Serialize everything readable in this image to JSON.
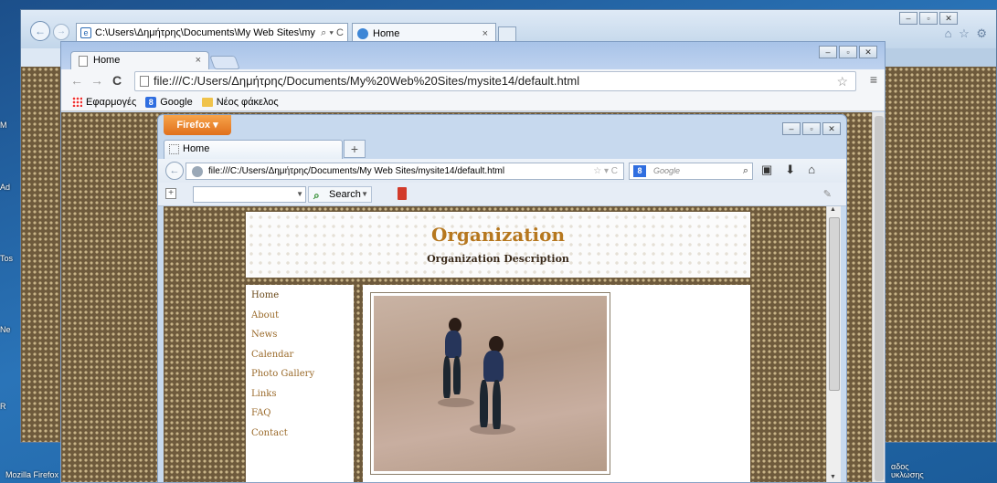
{
  "desktop": {
    "icons": [
      "M",
      "Ad",
      "Tos",
      "Ne",
      "R"
    ],
    "bottom_left": "Mozilla Firefox",
    "bottom_right": "αδος\nυκλωσης"
  },
  "ie": {
    "address": "C:\\Users\\Δημήτρης\\Documents\\My Web Sites\\my",
    "address_controls": "⌕ ▾ C",
    "tab_label": "Home",
    "tab_close": "×",
    "toolbar_icons": "⌂ ☆ ⚙"
  },
  "chrome": {
    "tab_label": "Home",
    "tab_close": "×",
    "url": "file:///C:/Users/Δημήτρης/Documents/My%20Web%20Sites/mysite14/default.html",
    "bookmarks": [
      {
        "label": "Εφαρμογές",
        "icon": "apps-icon"
      },
      {
        "label": "Google",
        "icon": "google-icon"
      },
      {
        "label": "Νέος φάκελος",
        "icon": "folder-icon"
      }
    ]
  },
  "firefox": {
    "menu_button": "Firefox ▾",
    "tab_label": "Home",
    "new_tab": "+",
    "url": "file:///C:/Users/Δημήτρης/Documents/My Web Sites/mysite14/default.html",
    "url_controls": "☆ ▾ C",
    "search_placeholder": "Google",
    "search_engine_icon": "8",
    "search_button": "Search"
  },
  "site": {
    "title": "Organization",
    "description": "Organization Description",
    "nav": [
      "Home",
      "About",
      "News",
      "Calendar",
      "Photo Gallery",
      "Links",
      "FAQ",
      "Contact"
    ]
  },
  "colors": {
    "site_title": "#b6771e",
    "nav_link": "#9a6a2a",
    "pattern": "#6e5a3c",
    "firefox_button": "#e0701d"
  }
}
